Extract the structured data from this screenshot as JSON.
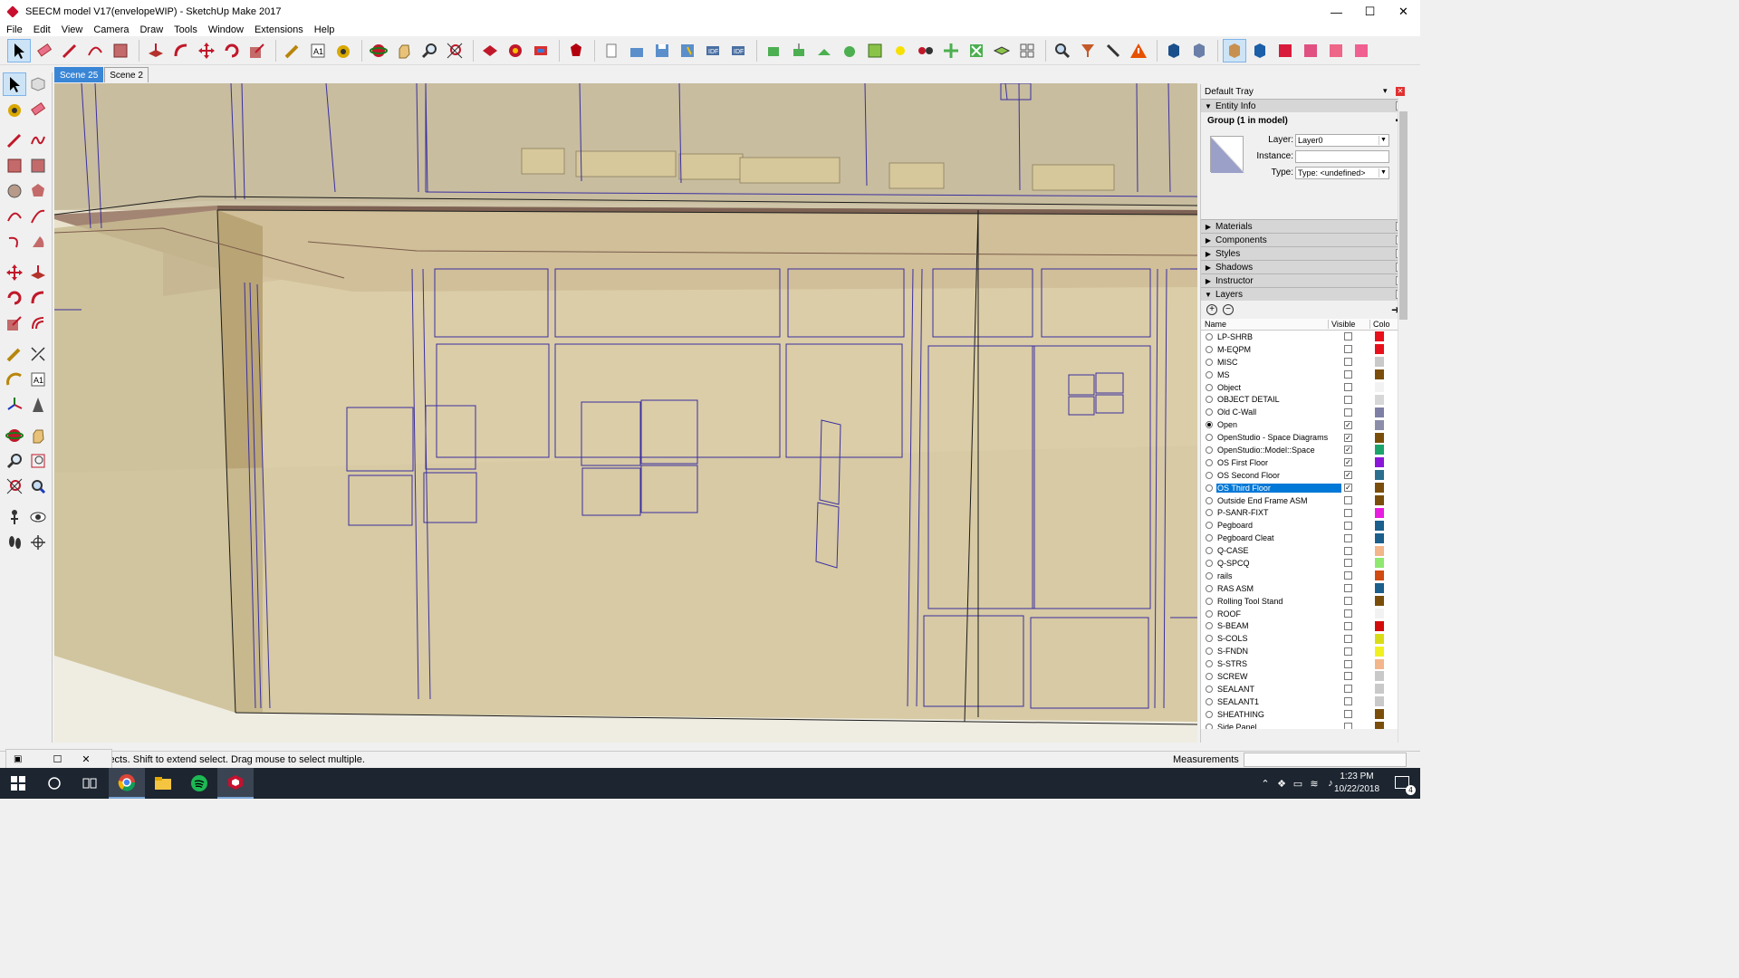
{
  "window": {
    "title": "SEECM model V17(envelopeWIP) - SketchUp Make 2017",
    "minimize": "—",
    "maximize": "☐",
    "close": "✕"
  },
  "menu": [
    "File",
    "Edit",
    "View",
    "Camera",
    "Draw",
    "Tools",
    "Window",
    "Extensions",
    "Help"
  ],
  "scenes": [
    {
      "label": "Scene 25",
      "active": true
    },
    {
      "label": "Scene 2",
      "active": false
    }
  ],
  "tray": {
    "title": "Default Tray",
    "pin": "📌",
    "close": "✕",
    "entity_info": {
      "header": "Entity Info",
      "group_label": "Group (1 in model)",
      "layer_label": "Layer:",
      "layer_value": "Layer0",
      "instance_label": "Instance:",
      "instance_value": "",
      "type_label": "Type:",
      "type_value": "Type: <undefined>"
    },
    "panels": [
      "Materials",
      "Components",
      "Styles",
      "Shadows",
      "Instructor"
    ],
    "layers": {
      "header": "Layers",
      "col_name": "Name",
      "col_visible": "Visible",
      "col_color": "Colo",
      "items": [
        {
          "name": "LP-SHRB",
          "visible": false,
          "color": "#e8101a",
          "active": false
        },
        {
          "name": "M-EQPM",
          "visible": false,
          "color": "#e8101a",
          "active": false
        },
        {
          "name": "MISC",
          "visible": false,
          "color": "#c9c9c9",
          "active": false
        },
        {
          "name": "MS",
          "visible": false,
          "color": "#7a4e0a",
          "active": false
        },
        {
          "name": "Object",
          "visible": false,
          "color": "#f2f2f2",
          "active": false
        },
        {
          "name": "OBJECT DETAIL",
          "visible": false,
          "color": "#d7d7d7",
          "active": false
        },
        {
          "name": "Old C-Wall",
          "visible": false,
          "color": "#7d7fa5",
          "active": false
        },
        {
          "name": "Open",
          "visible": true,
          "color": "#8c8ea9",
          "active": true
        },
        {
          "name": "OpenStudio - Space Diagrams",
          "visible": true,
          "color": "#7a4e0a",
          "active": false
        },
        {
          "name": "OpenStudio::Model::Space",
          "visible": true,
          "color": "#1aa36b",
          "active": false
        },
        {
          "name": "OS First Floor",
          "visible": true,
          "color": "#8a17d8",
          "active": false
        },
        {
          "name": "OS Second Floor",
          "visible": true,
          "color": "#2a6f8e",
          "active": false
        },
        {
          "name": "OS Third Floor",
          "visible": true,
          "color": "#7a4e0a",
          "active": false,
          "selected": true
        },
        {
          "name": "Outside End Frame ASM",
          "visible": false,
          "color": "#7a4e0a",
          "active": false
        },
        {
          "name": "P-SANR-FIXT",
          "visible": false,
          "color": "#e81ce0",
          "active": false
        },
        {
          "name": "Pegboard",
          "visible": false,
          "color": "#1b5f8c",
          "active": false
        },
        {
          "name": "Pegboard Cleat",
          "visible": false,
          "color": "#1b5f8c",
          "active": false
        },
        {
          "name": "Q-CASE",
          "visible": false,
          "color": "#f3b58a",
          "active": false
        },
        {
          "name": "Q-SPCQ",
          "visible": false,
          "color": "#8fe870",
          "active": false
        },
        {
          "name": "rails",
          "visible": false,
          "color": "#d14a10",
          "active": false
        },
        {
          "name": "RAS ASM",
          "visible": false,
          "color": "#1b5f8c",
          "active": false
        },
        {
          "name": "Rolling Tool Stand",
          "visible": false,
          "color": "#7a4e0a",
          "active": false
        },
        {
          "name": "ROOF",
          "visible": false,
          "color": "#f2f2f2",
          "active": false
        },
        {
          "name": "S-BEAM",
          "visible": false,
          "color": "#d40b0b",
          "active": false
        },
        {
          "name": "S-COLS",
          "visible": false,
          "color": "#d9dc14",
          "active": false
        },
        {
          "name": "S-FNDN",
          "visible": false,
          "color": "#f0f020",
          "active": false
        },
        {
          "name": "S-STRS",
          "visible": false,
          "color": "#f3b58a",
          "active": false
        },
        {
          "name": "SCREW",
          "visible": false,
          "color": "#c9c9c9",
          "active": false
        },
        {
          "name": "SEALANT",
          "visible": false,
          "color": "#c9c9c9",
          "active": false
        },
        {
          "name": "SEALANT1",
          "visible": false,
          "color": "#c9c9c9",
          "active": false
        },
        {
          "name": "SHEATHING",
          "visible": false,
          "color": "#7a4e0a",
          "active": false
        },
        {
          "name": "Side Panel",
          "visible": false,
          "color": "#7a4e0a",
          "active": false
        }
      ]
    }
  },
  "status": {
    "hint": "jects. Shift to extend select. Drag mouse to select multiple.",
    "measurements_label": "Measurements",
    "measurements_value": ""
  },
  "taskbar": {
    "time": "1:23 PM",
    "date": "10/22/2018",
    "notifications": "4"
  },
  "icons": {
    "toolbar": [
      "select-icon",
      "eraser-icon",
      "line-icon",
      "arc-icon",
      "rectangle-icon",
      "push-pull-icon",
      "follow-me-icon",
      "move-icon",
      "rotate-icon",
      "scale-icon",
      "tape-measure-icon",
      "text-icon",
      "paint-bucket-icon",
      "orbit-icon",
      "pan-icon",
      "zoom-icon",
      "zoom-extents-icon",
      "warehouse-icon",
      "share-model-icon",
      "extension-warehouse-icon",
      "ruby-icon"
    ],
    "colors": {
      "accent": "#0078d7",
      "viewport_bg": "#e6ddc6",
      "edge": "#3b2fa0",
      "beam": "#8e6d60"
    }
  }
}
